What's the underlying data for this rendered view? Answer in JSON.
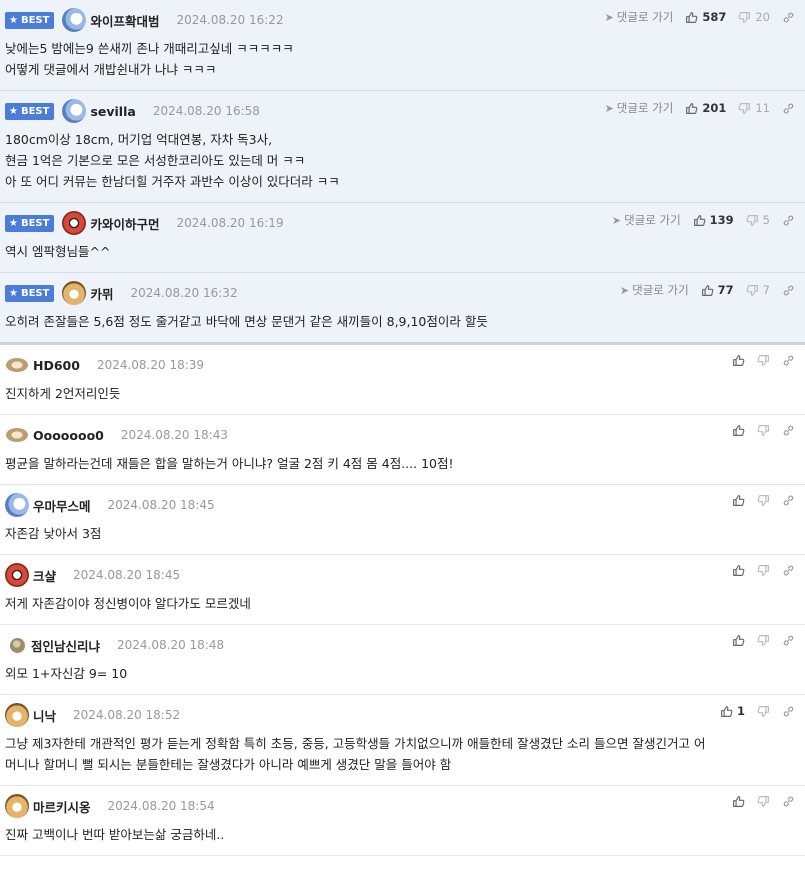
{
  "best_label": "BEST",
  "reply_label": "댓글로 가기",
  "comments": [
    {
      "best": true,
      "avatar": "blue-white-dog-avatar",
      "nick": "와이프확대범",
      "date": "2024.08.20 16:22",
      "up": "587",
      "down": "20",
      "text": "낮에는5 밤에는9 쓴새끼 존나 개때리고싶네 ㅋㅋㅋㅋㅋ\n어떻게 댓글에서 개밥쉰내가 나냐 ㅋㅋㅋ"
    },
    {
      "best": true,
      "avatar": "blue-white-dog-avatar",
      "nick": "sevilla",
      "date": "2024.08.20 16:58",
      "up": "201",
      "down": "11",
      "text": "180cm이상 18cm, 머기업 억대연봉, 자차 독3사,\n현금 1억은 기본으로 모은 서성한코리아도 있는데 머 ㅋㅋ\n아 또 어디 커뮤는 한남더힐 거주자 과반수 이상이 있다더라 ㅋㅋ"
    },
    {
      "best": true,
      "avatar": "red-dog-avatar",
      "nick": "카와이하구먼",
      "date": "2024.08.20 16:19",
      "up": "139",
      "down": "5",
      "text": "역시 엠팍형님들^^"
    },
    {
      "best": true,
      "avatar": "chihuahua-avatar",
      "nick": "카뮈",
      "date": "2024.08.20 16:32",
      "up": "77",
      "down": "7",
      "text": "오히려 존잘들은 5,6점 정도 줄거같고 바닥에 면상 문댄거 같은 새끼들이 8,9,10점이라 할듯"
    },
    {
      "best": false,
      "avatar": "flat-dog-avatar",
      "nick": "HD600",
      "date": "2024.08.20 18:39",
      "up": "",
      "down": "",
      "text": "진지하게 2언저리인듯"
    },
    {
      "best": false,
      "avatar": "flat-dog-avatar",
      "nick": "Ooooooo0",
      "date": "2024.08.20 18:43",
      "up": "",
      "down": "",
      "text": "평균을 말하라는건데 재들은 합을 말하는거 아니냐? 얼굴 2점 키 4점 몸 4점.... 10점!"
    },
    {
      "best": false,
      "avatar": "blue-white-dog-avatar",
      "nick": "우마무스메",
      "date": "2024.08.20 18:45",
      "up": "",
      "down": "",
      "text": "자존감 낮아서 3점"
    },
    {
      "best": false,
      "avatar": "red-dog-avatar",
      "nick": "크샬",
      "date": "2024.08.20 18:45",
      "up": "",
      "down": "",
      "text": "저게 자존감이야 정신병이야 알다가도 모르겠네"
    },
    {
      "best": false,
      "avatar": "dot-avatar",
      "nick": "점인남신리냐",
      "date": "2024.08.20 18:48",
      "up": "",
      "down": "",
      "text": "외모 1+자신감 9= 10"
    },
    {
      "best": false,
      "avatar": "chihuahua-avatar",
      "nick": "니낙",
      "date": "2024.08.20 18:52",
      "up": "1",
      "down": "",
      "text": "그냥 제3자한테 개관적인 평가 듣는게 정확함 특히 초등, 중등, 고등학생들 가치없으니까 애들한테 잘생겼단 소리 들으면 잘생긴거고 어\n머니나 할머니 뻘 되시는 분들한테는 잘생겼다가 아니라 예쁘게 생겼단 말을 들어야 함"
    },
    {
      "best": false,
      "avatar": "chihuahua-avatar",
      "nick": "마르키시옹",
      "date": "2024.08.20 18:54",
      "up": "",
      "down": "",
      "text": "진짜 고백이나 번따 받아보는삶 궁금하네.."
    }
  ],
  "colors": {
    "best_bg": "#eef2f9",
    "badge": "#4a7cd8",
    "date": "#999999"
  }
}
